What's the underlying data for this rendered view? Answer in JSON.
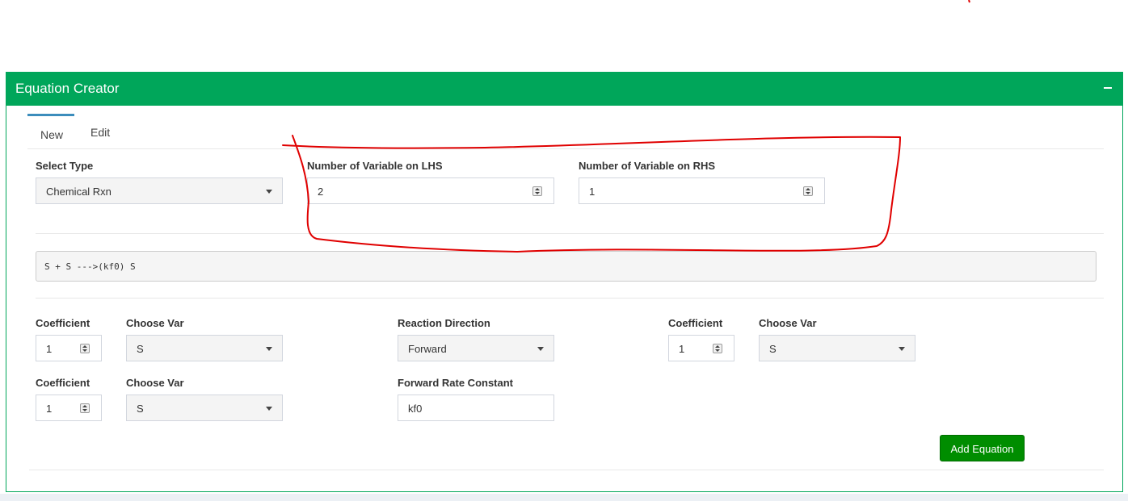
{
  "panel": {
    "title": "Equation Creator",
    "header_color": "#00a65a"
  },
  "tabs": [
    {
      "label": "New",
      "active": true
    },
    {
      "label": "Edit",
      "active": false
    }
  ],
  "form": {
    "select_type": {
      "label": "Select Type",
      "value": "Chemical Rxn"
    },
    "lhs_count": {
      "label": "Number of Variable on LHS",
      "value": "2"
    },
    "rhs_count": {
      "label": "Number of Variable on RHS",
      "value": "1"
    }
  },
  "equation_preview": "S + S --->(kf0) S",
  "lhs": [
    {
      "coef_label": "Coefficient",
      "coef_value": "1",
      "var_label": "Choose Var",
      "var_value": "S"
    },
    {
      "coef_label": "Coefficient",
      "coef_value": "1",
      "var_label": "Choose Var",
      "var_value": "S"
    }
  ],
  "direction": {
    "label": "Reaction Direction",
    "value": "Forward"
  },
  "forward_rate": {
    "label": "Forward Rate Constant",
    "value": "kf0"
  },
  "rhs": [
    {
      "coef_label": "Coefficient",
      "coef_value": "1",
      "var_label": "Choose Var",
      "var_value": "S"
    }
  ],
  "add_button": {
    "label": "Add Equation",
    "color": "#008d00"
  },
  "annotation_color": "#e00000"
}
